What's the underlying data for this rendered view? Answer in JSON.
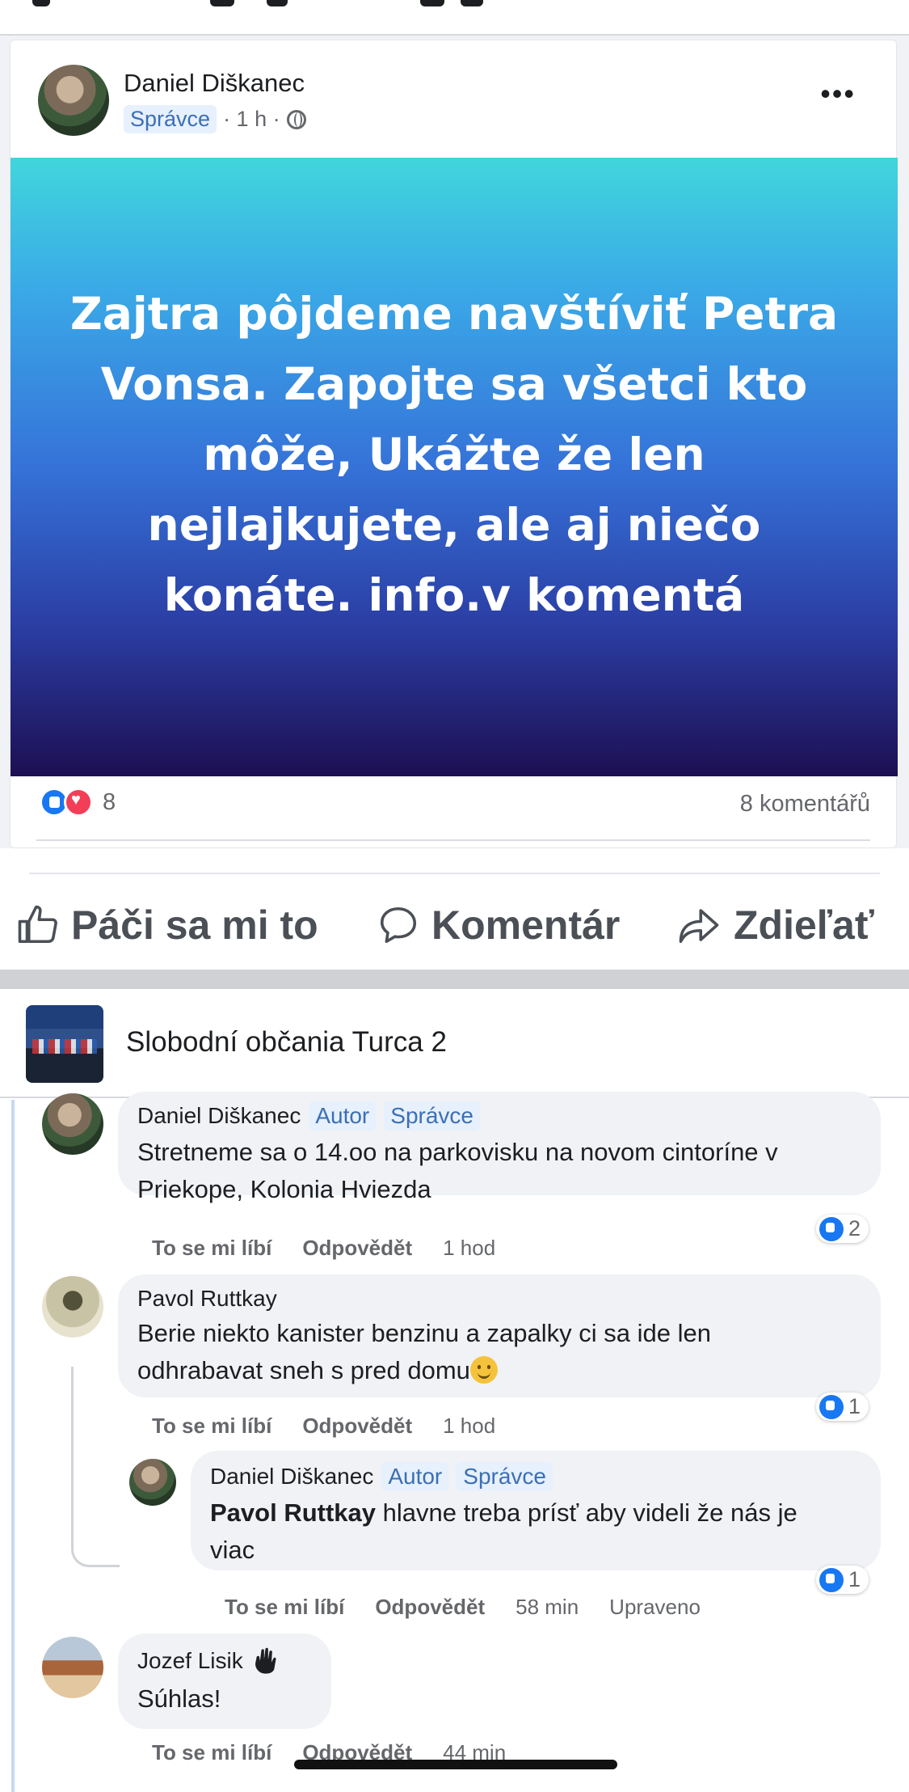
{
  "post": {
    "author": "Daniel Diškanec",
    "role_badge": "Správce",
    "time": "· 1 h ·",
    "banner_text": "Zajtra pôjdeme navštíviť Petra Vonsa. Zapojte sa všetci kto môže, Ukážte že len nejlajkujete, ale aj niečo konáte. info.v komentá",
    "reaction_count": "8",
    "comment_count": "8 komentářů"
  },
  "actions": {
    "like": "Páči sa mi to",
    "comment": "Komentár",
    "share": "Zdieľať"
  },
  "group": {
    "name": "Slobodní občania Turca 2"
  },
  "comments": [
    {
      "author": "Daniel Diškanec",
      "badges": [
        "Autor",
        "Správce"
      ],
      "text_lines": [
        "Stretneme sa o 14.oo na parkovisku na novom cintoríne v",
        "Priekope, Kolonia Hviezda"
      ],
      "like": "To se mi líbí",
      "reply": "Odpovědět",
      "time": "1 hod",
      "reactions": "2"
    },
    {
      "author": "Pavol Ruttkay",
      "text_lines": [
        "Berie niekto kanister benzinu a zapalky ci sa ide len",
        "odhrabavat sneh s pred domu"
      ],
      "emoji": "slightly-smiling-face",
      "like": "To se mi líbí",
      "reply": "Odpovědět",
      "time": "1 hod",
      "reactions": "1"
    },
    {
      "author": "Daniel Diškanec",
      "badges": [
        "Autor",
        "Správce"
      ],
      "mention": "Pavol Ruttkay",
      "text_lines": [
        " hlavne treba prísť aby videli že nás je",
        "viac"
      ],
      "like": "To se mi líbí",
      "reply": "Odpovědět",
      "time": "58 min",
      "edited": "Upraveno",
      "reactions": "1"
    },
    {
      "author": "Jozef Lisik",
      "author_icon": "waving-hand-icon",
      "text_lines": [
        "Súhlas!"
      ],
      "like": "To se mi líbí",
      "reply": "Odpovědět",
      "time": "44 min"
    }
  ],
  "colors": {
    "accent": "#1877f2",
    "love": "#f33e58",
    "badge_bg": "#e7f0fd",
    "badge_text": "#3b6fb6"
  }
}
